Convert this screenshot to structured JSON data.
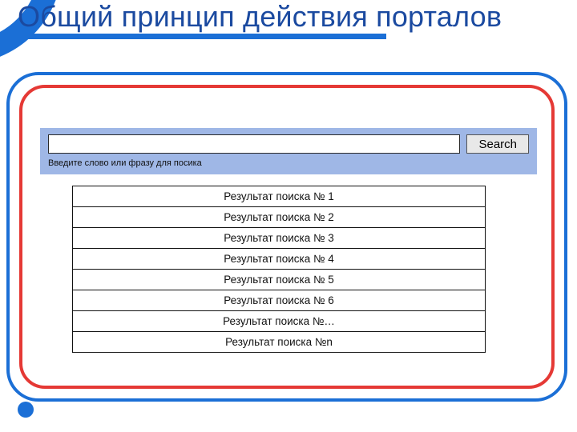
{
  "title": "Общий принцип действия порталов",
  "search": {
    "value": "",
    "button_label": "Search",
    "hint": "Введите слово или фразу для посика"
  },
  "results": [
    "Результат поиска № 1",
    "Результат поиска № 2",
    "Результат поиска № 3",
    "Результат поиска № 4",
    "Результат поиска № 5",
    "Результат поиска № 6",
    "Результат поиска №…",
    "Результат поиска №n"
  ],
  "colors": {
    "accent_blue": "#1b6fd6",
    "accent_red": "#e53935",
    "search_bg": "#9fb7e6",
    "title_text": "#1b4aa0"
  }
}
